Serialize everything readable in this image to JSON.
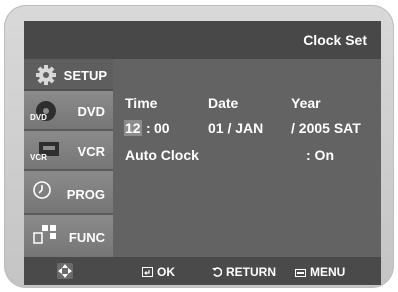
{
  "header": {
    "title": "Clock Set"
  },
  "sidebar": {
    "items": [
      {
        "label": "SETUP",
        "icon": "gear-icon",
        "active": true
      },
      {
        "label": "DVD",
        "icon": "dvd-disc-icon",
        "icon_text": "DVD"
      },
      {
        "label": "VCR",
        "icon": "vcr-cassette-icon",
        "icon_text": "VCR"
      },
      {
        "label": "PROG",
        "icon": "clock-icon"
      },
      {
        "label": "FUNC",
        "icon": "blocks-icon"
      }
    ]
  },
  "clock": {
    "headers": {
      "time": "Time",
      "date": "Date",
      "year": "Year"
    },
    "hour": "12",
    "separator": ":",
    "minute": "00",
    "date": "01 / JAN",
    "year": "/ 2005 SAT",
    "auto_clock_label": "Auto Clock",
    "auto_clock_value": ": On"
  },
  "footer": {
    "nav_icon": "dpad-icon",
    "ok_label": "OK",
    "return_label": "RETURN",
    "menu_label": "MENU"
  },
  "colors": {
    "screen_bg": "#636363",
    "bar_bg": "#484848",
    "highlight": "#8c8c8c",
    "text": "#ffffff"
  }
}
